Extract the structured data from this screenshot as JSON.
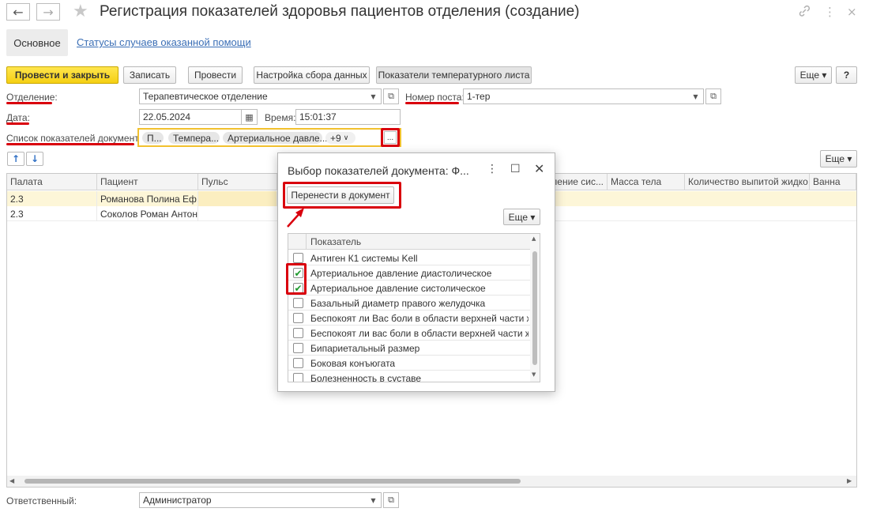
{
  "window": {
    "title": "Регистрация показателей здоровья пациентов отделения (создание)",
    "back_icon": "←",
    "forward_icon": "→",
    "favorite_icon": "★",
    "link_icon": "🔗",
    "menu_icon": "⋮",
    "close_icon": "×"
  },
  "tabs": {
    "main": "Основное",
    "statuses": "Статусы случаев оказанной помощи"
  },
  "toolbar": {
    "post_and_close": "Провести и закрыть",
    "save": "Записать",
    "post": "Провести",
    "data_collection_settings": "Настройка сбора данных",
    "temperature_sheet_indicators": "Показатели температурного листа",
    "more": "Еще ▾",
    "help": "?"
  },
  "form": {
    "department_label": "Отделение:",
    "department_value": "Терапевтическое отделение",
    "post_number_label": "Номер поста:",
    "post_number_value": "1-тер",
    "date_label": "Дата:",
    "date_value": "22.05.2024",
    "time_label": "Время:",
    "time_value": "15:01:37",
    "indicators_list_label": "Список показателей документа:",
    "indicator_tags": [
      "П...",
      "Темпера...",
      "Артериальное давле...",
      "+9"
    ],
    "select_button": "...",
    "responsible_label": "Ответственный:",
    "responsible_value": "Администратор"
  },
  "table_toolbar": {
    "move_up_icon": "↑",
    "move_down_icon": "↓",
    "more": "Еще ▾"
  },
  "table": {
    "columns": [
      "Палата",
      "Пациент",
      "Пульс",
      "...давление сис...",
      "Масса тела",
      "Количество выпитой жидко...",
      "Ванна"
    ],
    "rows": [
      {
        "ward": "2.3",
        "patient": "Романова Полина Еф..."
      },
      {
        "ward": "2.3",
        "patient": "Соколов Роман Антон..."
      }
    ]
  },
  "dialog": {
    "title": "Выбор показателей документа: Ф...",
    "transfer_button": "Перенести в документ",
    "more": "Еще ▾",
    "column_header": "Показатель",
    "items": [
      {
        "label": "Антиген К1 системы Kell",
        "checked": false
      },
      {
        "label": "Артериальное давление диастолическое",
        "checked": true
      },
      {
        "label": "Артериальное давление систолическое",
        "checked": true
      },
      {
        "label": "Базальный диаметр правого желудочка",
        "checked": false
      },
      {
        "label": "Беспокоят ли Вас боли в области верхней части жи...",
        "checked": false
      },
      {
        "label": "Беспокоят ли вас боли в области верхней части жи...",
        "checked": false
      },
      {
        "label": "Бипариетальный размер",
        "checked": false
      },
      {
        "label": "Боковая конъюгата",
        "checked": false
      },
      {
        "label": "Болезненность в суставе",
        "checked": false
      }
    ]
  },
  "colors": {
    "accent_yellow": "#f5cf13",
    "highlight_red": "#d9000d",
    "selected_row": "#fdf6d8",
    "link_blue": "#3b6fb6",
    "check_green": "#1f9a2e"
  }
}
